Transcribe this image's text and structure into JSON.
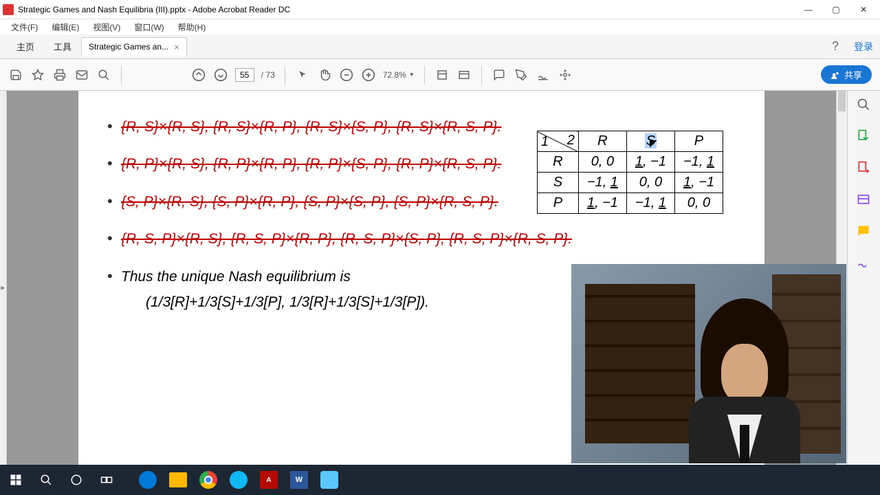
{
  "window": {
    "title": "Strategic Games and Nash Equilibria (III).pptx - Adobe Acrobat Reader DC"
  },
  "menus": {
    "file": "文件(F)",
    "edit": "编辑(E)",
    "view": "视图(V)",
    "window": "窗口(W)",
    "help": "帮助(H)"
  },
  "tabs": {
    "home": "主页",
    "tools": "工具",
    "doc_name": "Strategic Games an...",
    "login": "登录"
  },
  "toolbar": {
    "page_current": "55",
    "page_total": "/ 73",
    "zoom": "72.8%",
    "share": "共享"
  },
  "content": {
    "b1": "{R, S}×{R, S}, {R, S}×{R, P}, {R, S}×{S, P}, {R, S}×{R, S, P}.",
    "b2": "{R, P}×{R, S}, {R, P}×{R, P}, {R, P}×{S, P}, {R, P}×{R, S, P}.",
    "b3": "{S, P}×{R, S}, {S, P}×{R, P}, {S, P}×{S, P}, {S, P}×{R, S, P}.",
    "b4": "{R, S, P}×{R, S}, {R, S, P}×{R, P}, {R, S, P}×{S, P}, {R, S, P}×{R, S, P}.",
    "b5": "Thus the unique Nash equilibrium is",
    "nash": "(1/3[R]+1/3[S]+1/3[P], 1/3[R]+1/3[S]+1/3[P])."
  },
  "chart_data": {
    "type": "table",
    "title": "Payoff Matrix",
    "row_player": "1",
    "col_player": "2",
    "strategies": [
      "R",
      "S",
      "P"
    ],
    "payoffs": [
      [
        [
          0,
          0
        ],
        [
          1,
          -1
        ],
        [
          -1,
          1
        ]
      ],
      [
        [
          -1,
          1
        ],
        [
          0,
          0
        ],
        [
          1,
          -1
        ]
      ],
      [
        [
          1,
          -1
        ],
        [
          -1,
          1
        ],
        [
          0,
          0
        ]
      ]
    ],
    "highlighted_cell": {
      "row": 0,
      "col": 1,
      "header": "S"
    }
  },
  "taskbar": {
    "items": [
      "start",
      "search",
      "cortana",
      "taskview",
      "edge",
      "explorer",
      "chrome",
      "qq-browser",
      "acrobat",
      "word",
      "misc"
    ]
  }
}
